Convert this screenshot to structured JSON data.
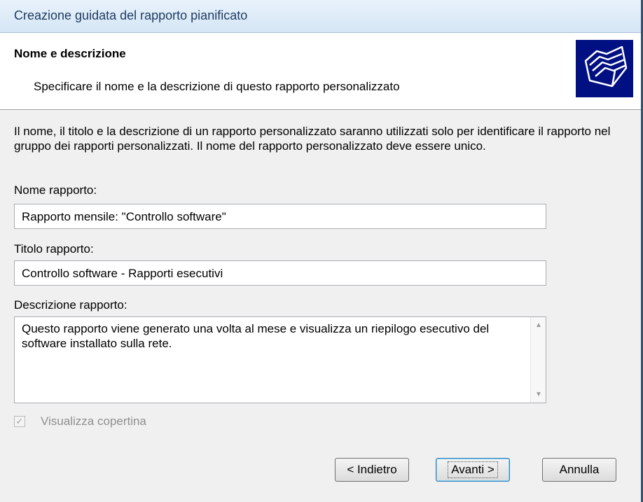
{
  "window": {
    "title": "Creazione guidata del rapporto pianificato"
  },
  "header": {
    "title": "Nome e descrizione",
    "subtitle": "Specificare il nome e la descrizione di questo rapporto personalizzato",
    "icon": "folders-icon"
  },
  "form": {
    "intro": "Il nome, il titolo e la descrizione di un rapporto personalizzato saranno utilizzati solo per identificare il rapporto nel gruppo dei rapporti personalizzati. Il nome del rapporto personalizzato deve essere unico.",
    "name_label": "Nome rapporto:",
    "name_value": "Rapporto mensile: \"Controllo software\"",
    "title_label": "Titolo rapporto:",
    "title_value": "Controllo software - Rapporti esecutivi",
    "description_label": "Descrizione rapporto:",
    "description_value": "Questo rapporto viene generato una volta al mese e visualizza un riepilogo esecutivo del software installato sulla rete.",
    "cover_checkbox_label": "Visualizza copertina",
    "cover_checked": true
  },
  "buttons": {
    "back": "< Indietro",
    "next": "Avanti >",
    "cancel": "Annulla"
  }
}
